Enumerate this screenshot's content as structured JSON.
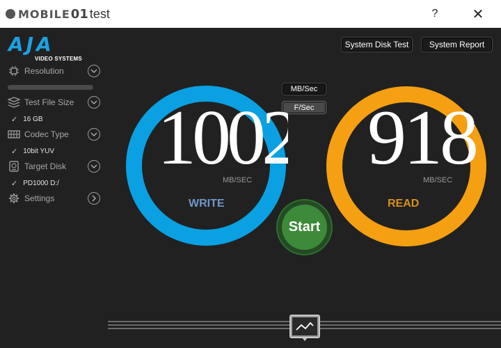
{
  "titlebar": {
    "watermark_text": "MOBILE",
    "watermark_num": "01",
    "title_fragment": "test",
    "help_label": "?",
    "close_label": "✕"
  },
  "logo": {
    "word": "AJA",
    "subtitle": "VIDEO SYSTEMS"
  },
  "sidebar": {
    "resolution": {
      "label": "Resolution",
      "icon": "chip-icon"
    },
    "test_file_size": {
      "label": "Test File Size",
      "icon": "stack-icon",
      "selected": "16 GB"
    },
    "codec_type": {
      "label": "Codec Type",
      "icon": "codec-icon",
      "selected": "10bit YUV"
    },
    "target_disk": {
      "label": "Target Disk",
      "icon": "disk-icon",
      "selected": "PD1000 D:/"
    },
    "settings": {
      "label": "Settings",
      "icon": "gear-icon"
    }
  },
  "toolbar": {
    "system_disk_test": "System Disk Test",
    "system_report": "System Report"
  },
  "units_toggle": {
    "mb_sec": "MB/Sec",
    "f_sec": "F/Sec",
    "active": "F/Sec"
  },
  "write": {
    "value": "1002",
    "unit": "MB/SEC",
    "label": "WRITE"
  },
  "read": {
    "value": "918",
    "unit": "MB/SEC",
    "label": "READ"
  },
  "start_label": "Start",
  "colors": {
    "background": "#212121",
    "write_ring": "#0aa0e1",
    "read_ring": "#f59f12",
    "start_green": "#3d8a3a",
    "aja_blue": "#1ba1e2"
  }
}
